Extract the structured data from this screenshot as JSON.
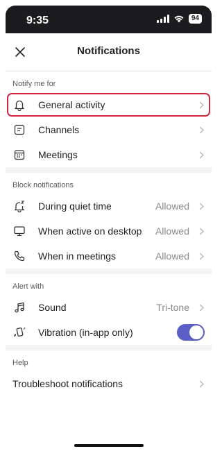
{
  "status_bar": {
    "time": "9:35",
    "battery": "94"
  },
  "header": {
    "title": "Notifications",
    "close_icon": "close-icon"
  },
  "sections": {
    "notify": {
      "label": "Notify me for",
      "items": [
        {
          "label": "General activity",
          "icon": "bell-icon"
        },
        {
          "label": "Channels",
          "icon": "channels-icon"
        },
        {
          "label": "Meetings",
          "icon": "calendar-icon"
        }
      ]
    },
    "block": {
      "label": "Block notifications",
      "items": [
        {
          "label": "During quiet time",
          "value": "Allowed",
          "icon": "quiet-time-icon"
        },
        {
          "label": "When active on desktop",
          "value": "Allowed",
          "icon": "desktop-icon"
        },
        {
          "label": "When in meetings",
          "value": "Allowed",
          "icon": "phone-icon"
        }
      ]
    },
    "alert": {
      "label": "Alert with",
      "items": [
        {
          "label": "Sound",
          "value": "Tri-tone",
          "icon": "music-note-icon"
        },
        {
          "label": "Vibration (in-app only)",
          "icon": "vibration-icon",
          "toggle": true
        }
      ]
    },
    "help": {
      "label": "Help",
      "items": [
        {
          "label": "Troubleshoot notifications"
        }
      ]
    }
  },
  "colors": {
    "highlight": "#d2243c",
    "toggle_on": "#5b5fc7"
  }
}
